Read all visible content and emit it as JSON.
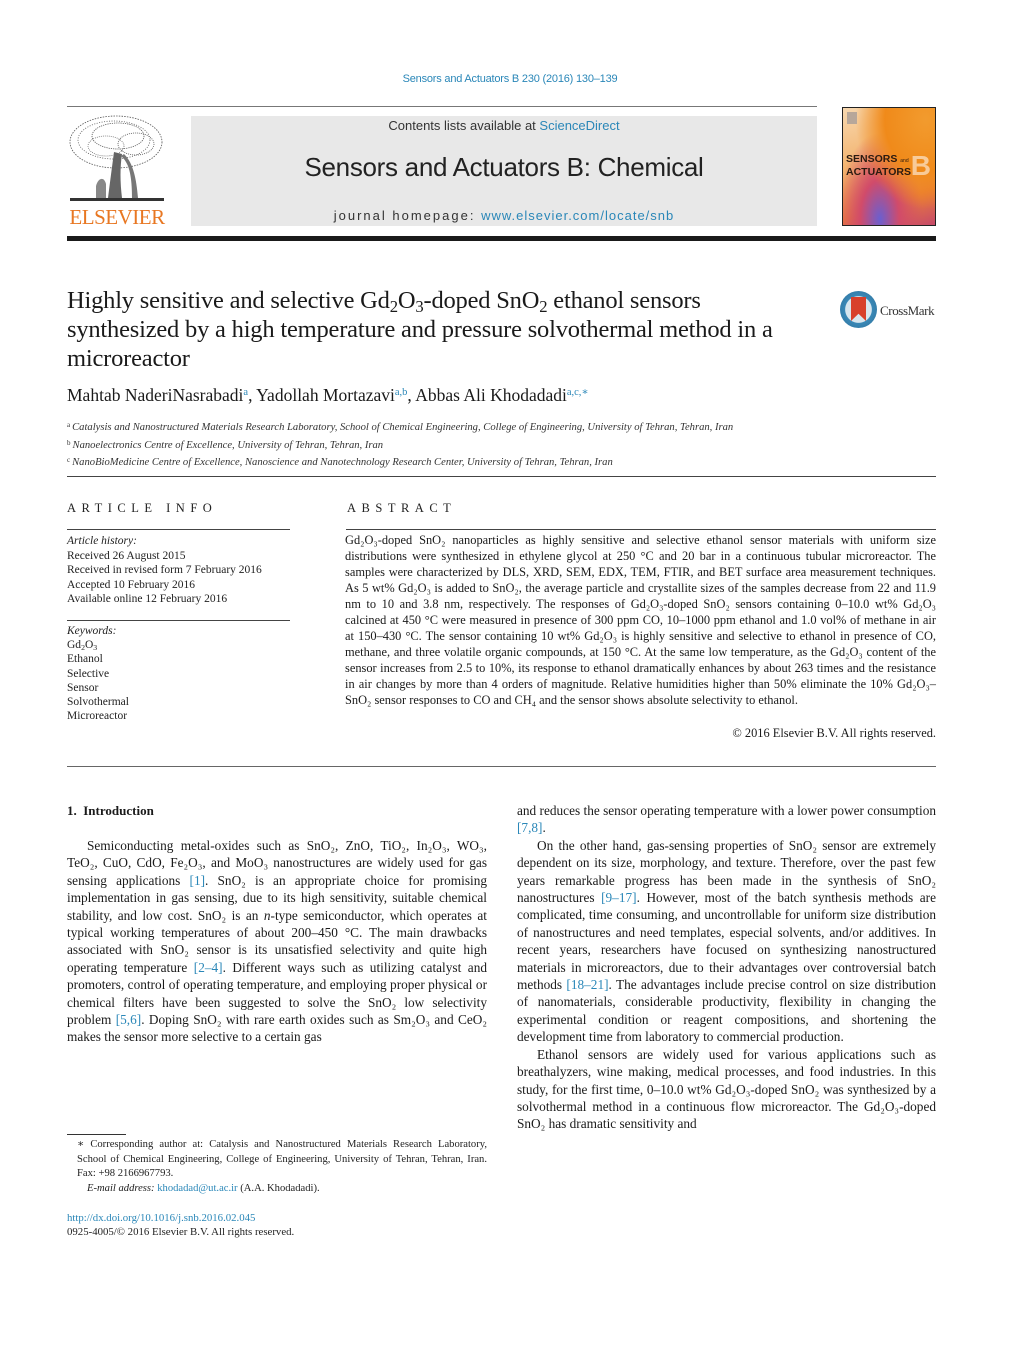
{
  "journal_ref": "Sensors and Actuators B 230 (2016) 130–139",
  "masthead": {
    "contents_prefix": "Contents lists available at ",
    "contents_link": "ScienceDirect",
    "journal_name": "Sensors and Actuators B: Chemical",
    "homepage_prefix": "journal homepage: ",
    "homepage_link": "www.elsevier.com/locate/snb",
    "publisher_logo_text": "ELSEVIER",
    "cover_title_line1": "SENSORS",
    "cover_title_and": "and",
    "cover_title_line2": "ACTUATORS",
    "cover_letter": "B",
    "brand_color": "#e87722",
    "link_color": "#2a87b8"
  },
  "article": {
    "title_parts": [
      "Highly sensitive and selective Gd",
      "2",
      "O",
      "3",
      "-doped SnO",
      "2",
      " ethanol sensors synthesized by a high temperature and pressure solvothermal method in a microreactor"
    ],
    "crossmark_label": "CrossMark",
    "authors": [
      {
        "name": "Mahtab NaderiNasrabadi",
        "affil": "a"
      },
      {
        "name": "Yadollah Mortazavi",
        "affil": "a,b"
      },
      {
        "name": "Abbas Ali Khodadadi",
        "affil": "a,c,∗"
      }
    ],
    "affiliations": [
      {
        "mark": "a",
        "text": "Catalysis and Nanostructured Materials Research Laboratory, School of Chemical Engineering, College of Engineering, University of Tehran, Tehran, Iran"
      },
      {
        "mark": "b",
        "text": "Nanoelectronics Centre of Excellence, University of Tehran, Tehran, Iran"
      },
      {
        "mark": "c",
        "text": "NanoBioMedicine Centre of Excellence, Nanoscience and Nanotechnology Research Center, University of Tehran, Tehran, Iran"
      }
    ]
  },
  "article_info": {
    "heading": "ARTICLE INFO",
    "history_label": "Article history:",
    "history": [
      "Received 26 August 2015",
      "Received in revised form 7 February 2016",
      "Accepted 10 February 2016",
      "Available online 12 February 2016"
    ],
    "keywords_label": "Keywords:",
    "keywords": [
      "Gd2O3",
      "Ethanol",
      "Selective",
      "Sensor",
      "Solvothermal",
      "Microreactor"
    ]
  },
  "abstract": {
    "heading": "ABSTRACT",
    "text": "Gd₂O₃-doped SnO₂ nanoparticles as highly sensitive and selective ethanol sensor materials with uniform size distributions were synthesized in ethylene glycol at 250 °C and 20 bar in a continuous tubular microreactor. The samples were characterized by DLS, XRD, SEM, EDX, TEM, FTIR, and BET surface area measurement techniques. As 5 wt% Gd₂O₃ is added to SnO₂, the average particle and crystallite sizes of the samples decrease from 22 and 11.9 nm to 10 and 3.8 nm, respectively. The responses of Gd₂O₃-doped SnO₂ sensors containing 0–10.0 wt% Gd₂O₃ calcined at 450 °C were measured in presence of 300 ppm CO, 10–1000 ppm ethanol and 1.0 vol% of methane in air at 150–430 °C. The sensor containing 10 wt% Gd₂O₃ is highly sensitive and selective to ethanol in presence of CO, methane, and three volatile organic compounds, at 150 °C. At the same low temperature, as the Gd₂O₃ content of the sensor increases from 2.5 to 10%, its response to ethanol dramatically enhances by about 263 times and the resistance in air changes by more than 4 orders of magnitude. Relative humidities higher than 50% eliminate the 10% Gd₂O₃–SnO₂ sensor responses to CO and CH₄ and the sensor shows absolute selectivity to ethanol.",
    "copyright": "© 2016 Elsevier B.V. All rights reserved."
  },
  "introduction": {
    "heading": "1.  Introduction",
    "left_paragraphs": [
      {
        "indent": true,
        "segments": [
          {
            "t": "Semiconducting metal-oxides such as SnO₂, ZnO, TiO₂, In₂O₃, WO₃, TeO₂, CuO, CdO, Fe₂O₃, and MoO₃ nanostructures are widely used for gas sensing applications "
          },
          {
            "t": "[1]",
            "ref": true
          },
          {
            "t": ". SnO₂ is an appropriate choice for promising implementation in gas sensing, due to its high sensitivity, suitable chemical stability, and low cost. SnO₂ is an "
          },
          {
            "t": "n",
            "italic": true
          },
          {
            "t": "-type semiconductor, which operates at typical working temperatures of about 200–450 °C. The main drawbacks associated with SnO₂ sensor is its unsatisfied selectivity and quite high operating temperature "
          },
          {
            "t": "[2–4]",
            "ref": true
          },
          {
            "t": ". Different ways such as utilizing catalyst and promoters, control of operating temperature, and employing proper physical or chemical filters have been suggested to solve the SnO₂ low selectivity problem "
          },
          {
            "t": "[5,6]",
            "ref": true
          },
          {
            "t": ". Doping SnO₂ with rare earth oxides such as Sm₂O₃ and CeO₂ makes the sensor more selective to a certain gas"
          }
        ]
      }
    ],
    "right_paragraphs": [
      {
        "indent": false,
        "segments": [
          {
            "t": "and reduces the sensor operating temperature with a lower power consumption "
          },
          {
            "t": "[7,8]",
            "ref": true
          },
          {
            "t": "."
          }
        ]
      },
      {
        "indent": true,
        "segments": [
          {
            "t": "On the other hand, gas-sensing properties of SnO₂ sensor are extremely dependent on its size, morphology, and texture. Therefore, over the past few years remarkable progress has been made in the synthesis of SnO₂ nanostructures "
          },
          {
            "t": "[9–17]",
            "ref": true
          },
          {
            "t": ". However, most of the batch synthesis methods are complicated, time consuming, and uncontrollable for uniform size distribution of nanostructures and need templates, especial solvents, and/or additives. In recent years, researchers have focused on synthesizing nanostructured materials in microreactors, due to their advantages over controversial batch methods "
          },
          {
            "t": "[18–21]",
            "ref": true
          },
          {
            "t": ". The advantages include precise control on size distribution of nanomaterials, considerable productivity, flexibility in changing the experimental condition or reagent compositions, and shortening the development time from laboratory to commercial production."
          }
        ]
      },
      {
        "indent": true,
        "segments": [
          {
            "t": "Ethanol sensors are widely used for various applications such as breathalyzers, wine making, medical processes, and food industries. In this study, for the first time, 0–10.0 wt% Gd₂O₃-doped SnO₂ was synthesized by a solvothermal method in a continuous flow microreactor. The Gd₂O₃-doped SnO₂ has dramatic sensitivity and"
          }
        ]
      }
    ]
  },
  "footnote": {
    "star": "∗",
    "corresponding": "Corresponding author at: Catalysis and Nanostructured Materials Research Laboratory, School of Chemical Engineering, College of Engineering, University of Tehran, Tehran, Iran. Fax: +98 2166967793.",
    "email_label": "E-mail address:",
    "email": "khodadad@ut.ac.ir",
    "email_suffix": " (A.A. Khodadadi).",
    "doi": "http://dx.doi.org/10.1016/j.snb.2016.02.045",
    "issn": "0925-4005/© 2016 Elsevier B.V. All rights reserved."
  }
}
